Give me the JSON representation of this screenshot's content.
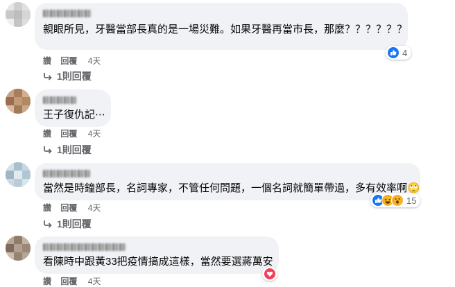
{
  "comments": [
    {
      "text": "親眼所見，牙醫當部長真的是一場災難。如果牙醫再當市長，那麼？？？？？？",
      "actions": {
        "like": "讚",
        "reply": "回覆",
        "time": "4天"
      },
      "replies": "1則回覆",
      "reactions": {
        "icons": [
          "like-icon"
        ],
        "count": "4"
      }
    },
    {
      "text": "王子復仇記⋯",
      "actions": {
        "like": "讚",
        "reply": "回覆",
        "time": "4天"
      },
      "replies": "1則回覆"
    },
    {
      "text": "當然是時鐘部長，名詞專家，不管任何問題，一個名詞就簡單帶過，多有效率啊🙄",
      "actions": {
        "like": "讚",
        "reply": "回覆",
        "time": "4天"
      },
      "replies": "1則回覆",
      "reactions": {
        "icons": [
          "like-icon",
          "haha-icon",
          "wow-icon"
        ],
        "count": "15"
      }
    },
    {
      "text": "看陳時中跟黃33把疫情搞成這樣，當然要選蔣萬安",
      "actions": {
        "like": "讚",
        "reply": "回覆",
        "time": "4天"
      },
      "reactions": {
        "icons": [
          "love-icon"
        ]
      }
    }
  ],
  "colors": {
    "bubble": "#f0f2f5",
    "like": "#1877f2",
    "love": "#f33e58",
    "muted": "#65676b"
  }
}
